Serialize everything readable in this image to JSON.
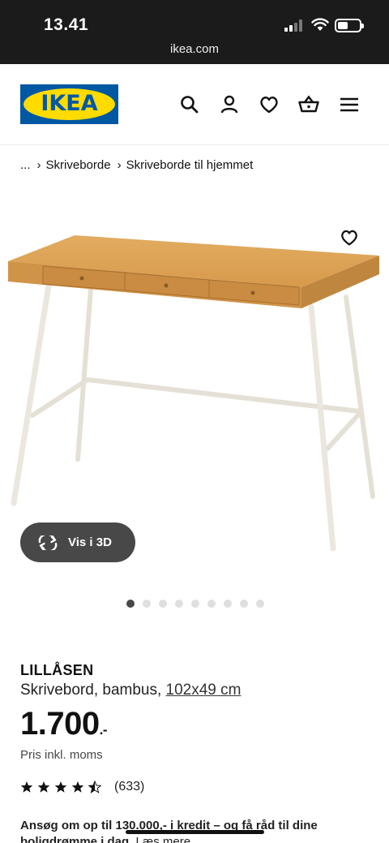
{
  "status_bar": {
    "time": "13.41",
    "url": "ikea.com"
  },
  "header": {
    "logo_text": "IKEA",
    "icons": [
      "search-icon",
      "profile-icon",
      "heart-icon",
      "basket-icon",
      "menu-icon"
    ]
  },
  "breadcrumb": {
    "ellipsis": "...",
    "items": [
      "Skriveborde",
      "Skriveborde til hjemmet"
    ]
  },
  "gallery": {
    "view_3d_label": "Vis i 3D",
    "image_count": 9,
    "active_index": 0
  },
  "product": {
    "name": "LILLÅSEN",
    "description": "Skrivebord, bambus,",
    "size": "102x49 cm",
    "price": "1.700",
    "price_suffix": ".-",
    "price_note": "Pris inkl. moms",
    "rating_stars": 4.5,
    "rating_count": "(633)"
  },
  "promo": {
    "text": "Ansøg om op til 130.000,- i kredit – og få råd til dine boligdrømme i dag.",
    "link": "Læs mere"
  },
  "colors": {
    "ikea_blue": "#0058a3",
    "ikea_yellow": "#ffdb00",
    "bamboo": "#d9a55a"
  }
}
